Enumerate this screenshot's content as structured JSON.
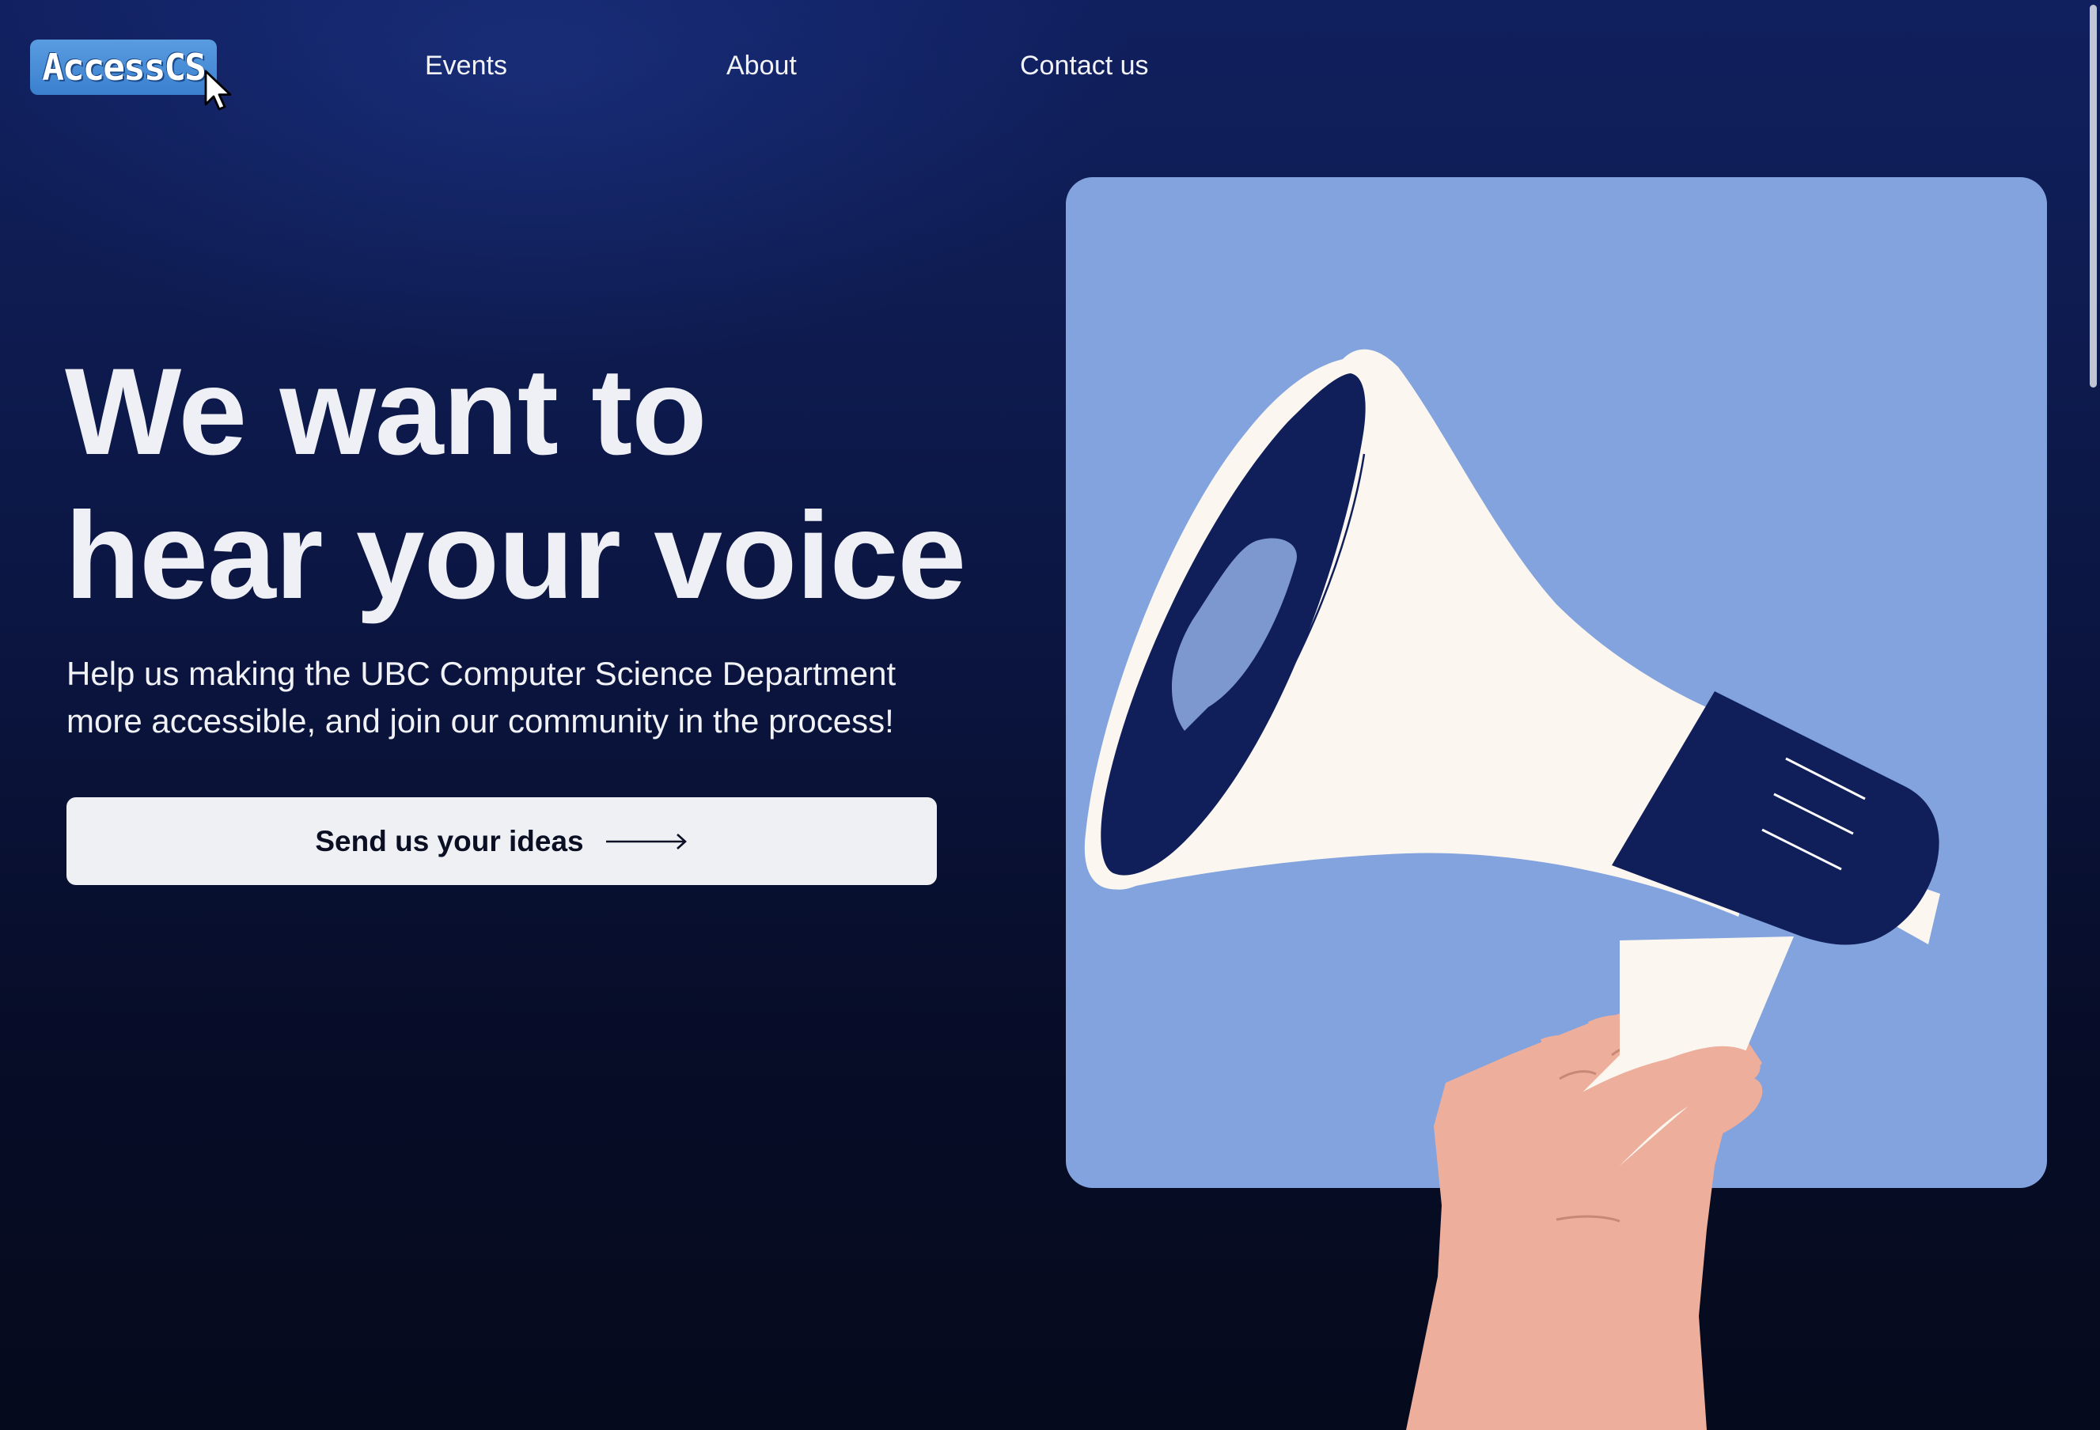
{
  "header": {
    "logo_text": "AccessCS",
    "nav": [
      {
        "label": "Events"
      },
      {
        "label": "About"
      },
      {
        "label": "Contact us"
      }
    ]
  },
  "hero": {
    "title_lines": [
      "We want to",
      "hear your voice"
    ],
    "subtitle_lines": [
      "Help us making the UBC Computer Science Department",
      "more accessible, and join our community in the process!"
    ],
    "cta_label": "Send us your ideas"
  },
  "illustration": {
    "subject": "hand holding megaphone",
    "icons": [
      "megaphone-icon",
      "arrow-right-icon",
      "cursor-icon"
    ]
  },
  "colors": {
    "background_top": "#101f5e",
    "background_bottom": "#050a1c",
    "card": "#82a3dd",
    "megaphone_navy": "#101e5a",
    "megaphone_cream": "#fbf7f0",
    "skin": "#eeae9c",
    "logo": "#3a80cf",
    "cta_bg": "#eef0f4"
  }
}
